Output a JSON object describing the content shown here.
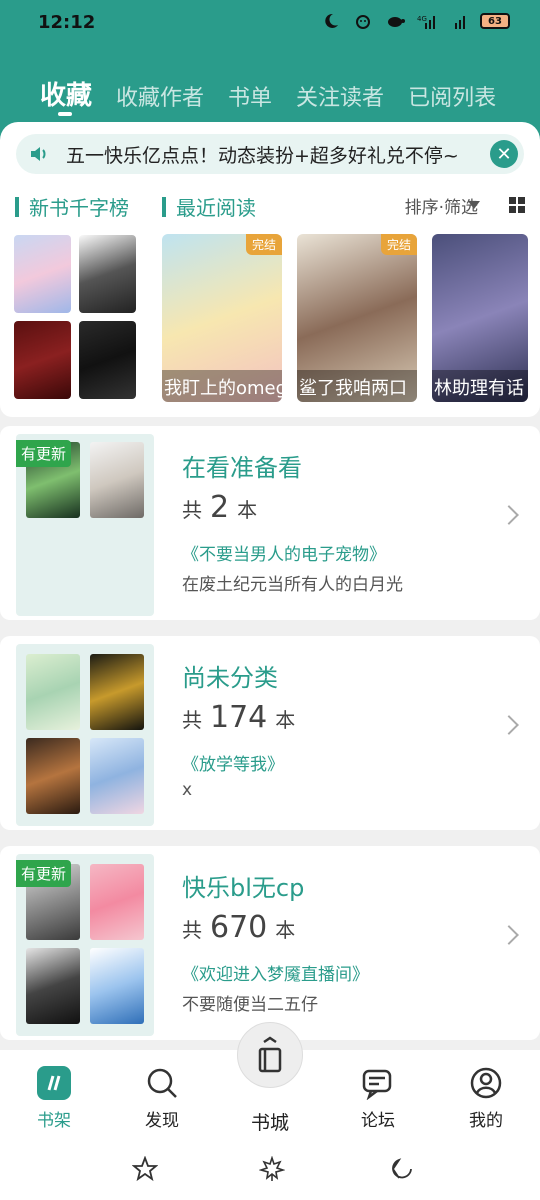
{
  "status": {
    "time": "12:12",
    "battery": "63"
  },
  "tabs": [
    {
      "label": "收藏",
      "active": true
    },
    {
      "label": "收藏作者"
    },
    {
      "label": "书单"
    },
    {
      "label": "关注读者"
    },
    {
      "label": "已阅列表"
    }
  ],
  "notice": {
    "text": "五一快乐亿点点！动态装扮+超多好礼兑不停~"
  },
  "sections": {
    "new_books": "新书千字榜",
    "recent": "最近阅读",
    "sort": "排序·筛选"
  },
  "recent_books": [
    {
      "title": "我盯上的omega",
      "tag": "完结"
    },
    {
      "title": "鲨了我咱两口",
      "tag": "完结"
    },
    {
      "title": "林助理有话"
    }
  ],
  "folders": [
    {
      "name": "在看准备看",
      "count_prefix": "共",
      "count": "2",
      "count_suffix": "本",
      "book": "《不要当男人的电子宠物》",
      "sub": "在废土纪元当所有人的白月光",
      "badge": "有更新"
    },
    {
      "name": "尚未分类",
      "count_prefix": "共",
      "count": "174",
      "count_suffix": "本",
      "book": "《放学等我》",
      "sub": "x"
    },
    {
      "name": "快乐bl无cp",
      "count_prefix": "共",
      "count": "670",
      "count_suffix": "本",
      "book": "《欢迎进入梦魇直播间》",
      "sub": "不要随便当二五仔",
      "badge": "有更新"
    }
  ],
  "bottom_nav": {
    "shelf": "书架",
    "discover": "发现",
    "store": "书城",
    "forum": "论坛",
    "mine": "我的"
  },
  "colors": {
    "accent": "#2a9c8b",
    "badge": "#2fa54c"
  }
}
